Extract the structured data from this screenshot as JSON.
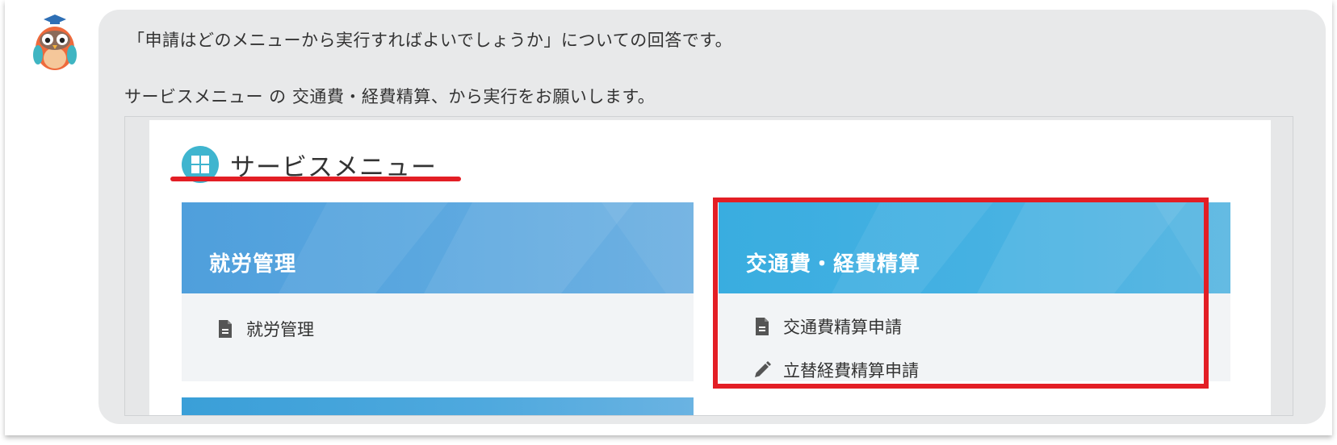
{
  "chat": {
    "avatar_icon": "owl-mascot-icon",
    "line1": "「申請はどのメニューから実行すればよいでしょうか」についての回答です。",
    "line2": "サービスメニュー の 交通費・経費精算、から実行をお願いします。"
  },
  "screenshot": {
    "menu_icon": "grid-icon",
    "menu_title": "サービスメニュー",
    "highlight_color": "#e31e25",
    "cards": [
      {
        "title": "就労管理",
        "header_color": "#5aa7df",
        "items": [
          {
            "icon": "document-icon",
            "label": "就労管理"
          }
        ]
      },
      {
        "title": "交通費・経費精算",
        "header_color": "#45b1e2",
        "items": [
          {
            "icon": "document-icon",
            "label": "交通費精算申請"
          },
          {
            "icon": "pencil-icon",
            "label": "立替経費精算申請"
          }
        ]
      }
    ]
  }
}
